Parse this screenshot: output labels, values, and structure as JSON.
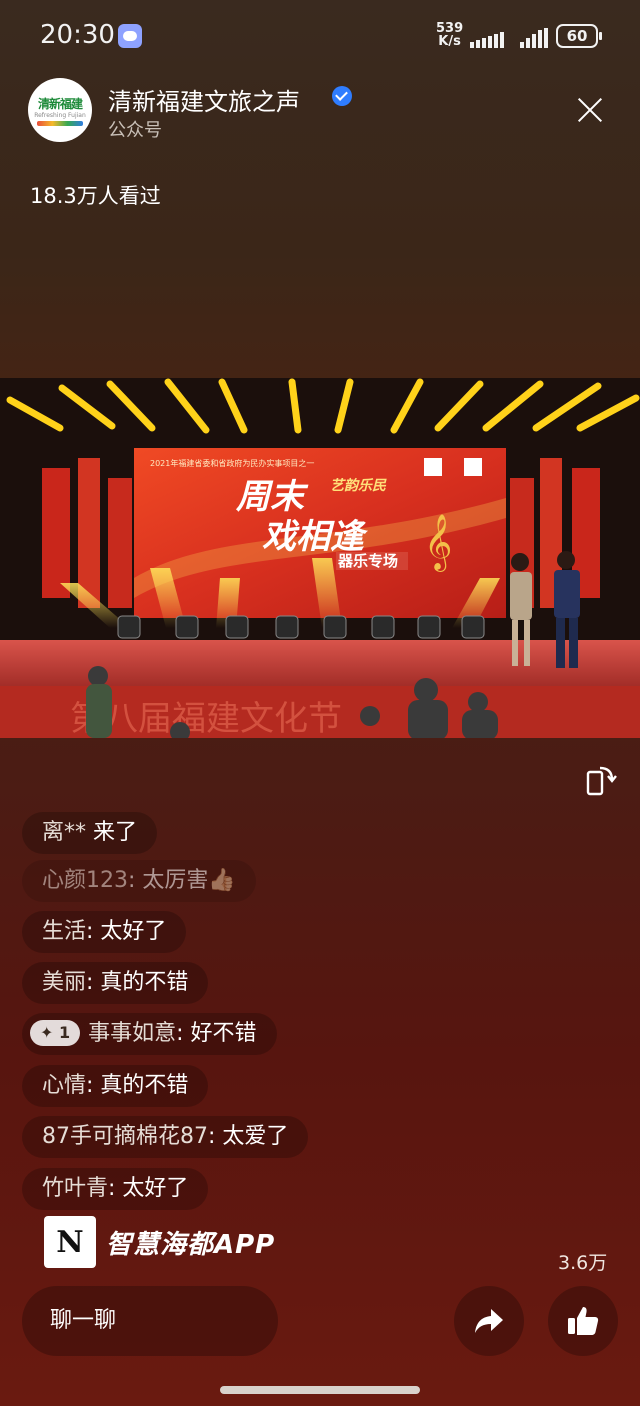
{
  "status_bar": {
    "time": "20:30",
    "net_speed_value": "539",
    "net_speed_unit": "K/s",
    "battery": "60"
  },
  "header": {
    "account_name": "清新福建文旅之声",
    "account_type": "公众号",
    "avatar_text": "清新福建",
    "avatar_subtext": "Refreshing Fujian"
  },
  "view_count": "18.3万人看过",
  "video": {
    "screen_header": "2021年福建省委和省政府为民办实事项目之一",
    "title_line1": "周末",
    "title_line2": "戏相逢",
    "title_badge": "艺韵乐民",
    "subtitle": "器乐专场",
    "bottom_text": "第八届福建文化节"
  },
  "comments": [
    {
      "user": "离**",
      "sep": " ",
      "text": "来了",
      "badge": ""
    },
    {
      "user": "心颜123",
      "sep": ": ",
      "text": "太厉害👍🏼",
      "badge": ""
    },
    {
      "user": "生活",
      "sep": ": ",
      "text": "太好了",
      "badge": ""
    },
    {
      "user": "美丽",
      "sep": ": ",
      "text": "真的不错",
      "badge": ""
    },
    {
      "user": "事事如意",
      "sep": ": ",
      "text": "好不错",
      "badge": "✦ 1"
    },
    {
      "user": "心情",
      "sep": ": ",
      "text": "真的不错",
      "badge": ""
    },
    {
      "user": "87手可摘棉花87",
      "sep": ": ",
      "text": "太爱了",
      "badge": ""
    },
    {
      "user": "竹叶青",
      "sep": ": ",
      "text": "太好了",
      "badge": ""
    }
  ],
  "watermark": {
    "logo_letter": "N",
    "text": "智慧海都APP"
  },
  "like_count": "3.6万",
  "chat_input": {
    "label": "聊一聊"
  },
  "icons": {
    "share": "share-icon",
    "like": "thumbs-up-icon",
    "rotate": "rotate-screen-icon",
    "close": "close-icon"
  },
  "colors": {
    "verified": "#2f7dff",
    "stage_red": "#d8301f",
    "stage_light": "#ffd21a"
  }
}
